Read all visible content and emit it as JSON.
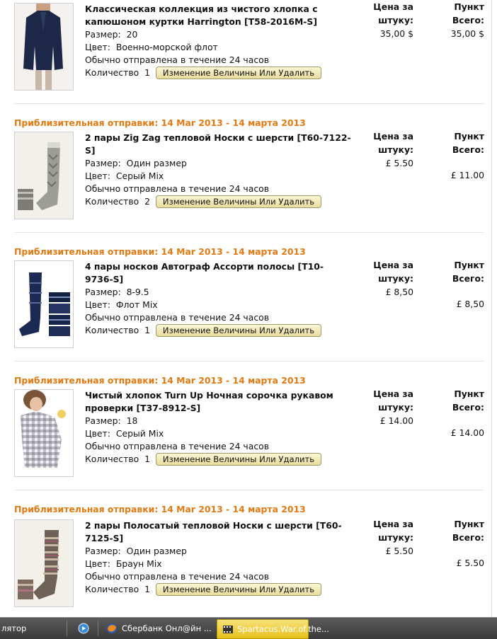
{
  "ship_label": "Приблизительная отправки: 14 Mar 2013 - 14 марта 2013",
  "labels": {
    "size": "Размер:",
    "color": "Цвет:",
    "shipping": "Обычно отправлена в течение 24 часов",
    "quantity": "Количество",
    "button": "Изменение Величины Или Удалить",
    "unit_price_1": "Цена за",
    "unit_price_2": "штуку:",
    "item_total": "Пункт Всего:"
  },
  "items": [
    {
      "title_1": "Классическая коллекция из чистого хлопка с",
      "title_2": "капюшоном куртки Harrington [T58-2016M-S]",
      "size": "20",
      "color": "Военно-морской флот",
      "qty": "1",
      "unit_price": "35,00 $",
      "total": "35,00 $",
      "image": "jacket"
    },
    {
      "title_1": "2 пары Zig Zag тепловой Носки с шерсти [T60-7122-",
      "title_2": "S]",
      "size": "Один размер",
      "color": "Серый Mix",
      "qty": "2",
      "unit_price": "£ 5.50",
      "total": "£ 11.00",
      "image": "grey-socks"
    },
    {
      "title_1": "4 пары носков Автограф Ассорти полосы [T10-",
      "title_2": "9736-S]",
      "size": "8-9.5",
      "color": "Флот Mix",
      "qty": "1",
      "unit_price": "£ 8,50",
      "total": "£ 8,50",
      "image": "navy-socks"
    },
    {
      "title_1": "Чистый хлопок Turn Up Ночная сорочка рукавом",
      "title_2": "проверки [T37-8912-S]",
      "size": "18",
      "color": "Серый Mix",
      "qty": "1",
      "unit_price": "£ 14.00",
      "total": "£ 14.00",
      "image": "nightshirt"
    },
    {
      "title_1": "2 пары Полосатый тепловой Носки с шерсти [T60-",
      "title_2": "7125-S]",
      "size": "Один размер",
      "color": "Браун Mix",
      "qty": "1",
      "unit_price": "£ 5.50",
      "total": "£ 5.50",
      "image": "brown-socks"
    }
  ],
  "taskbar": {
    "left_text": "лятор",
    "window_1": "Сбербанк Онл@йн ...",
    "window_2": "Spartacus.War.of.the..."
  },
  "colors": {
    "accent_orange": "#e47911",
    "button_fill": "#f2e7b2",
    "taskbar_active": "#f0d03a"
  }
}
